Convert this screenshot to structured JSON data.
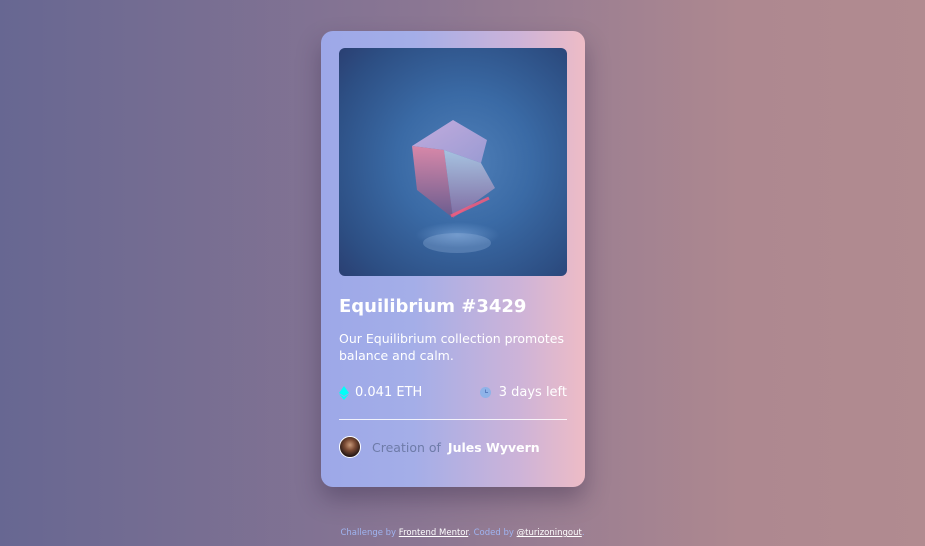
{
  "card": {
    "title": "Equilibrium #3429",
    "description": "Our Equilibrium collection promotes balance and calm.",
    "price": "0.041 ETH",
    "time_left": "3 days left",
    "creator_prefix": "Creation of",
    "creator_name": "Jules Wyvern"
  },
  "footer": {
    "challenge_text": "Challenge by",
    "challenge_link": "Frontend Mentor",
    "coded_text": "Coded by",
    "coded_link": "@turizoningout"
  },
  "icons": {
    "price": "ethereum-icon",
    "time": "clock-icon"
  },
  "colors": {
    "eth_accent": "#00fff8",
    "clock_accent": "#8fb3e8",
    "creator_prefix": "#6e7ba8",
    "footer_text": "#9fb4f0"
  }
}
